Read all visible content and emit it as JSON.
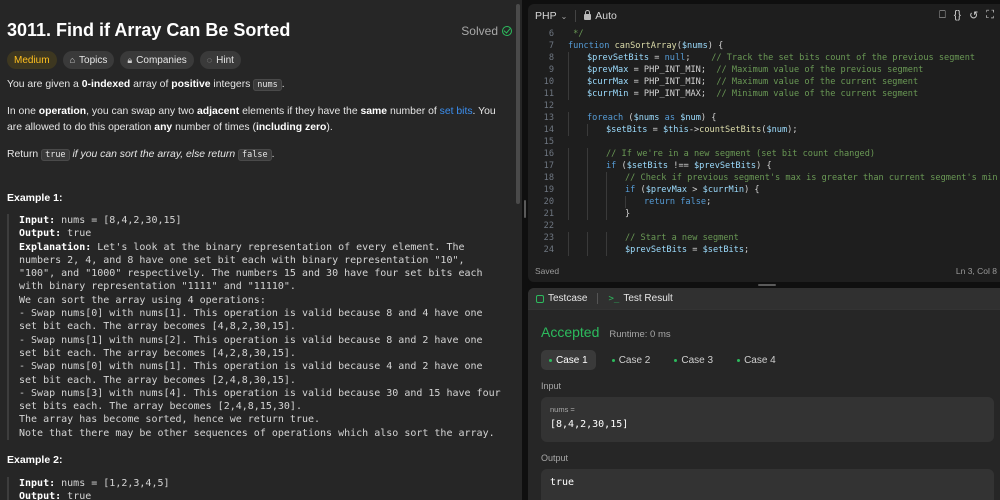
{
  "problem": {
    "title": "3011. Find if Array Can Be Sorted",
    "solved_label": "Solved",
    "tags": [
      "Medium",
      "Topics",
      "Companies",
      "Hint"
    ],
    "intro_1": "You are given a ",
    "intro_bold1": "0-indexed",
    "intro_2": " array of ",
    "intro_bold2": "positive",
    "intro_3": " integers ",
    "intro_code": "nums",
    "intro_4": ".",
    "p2_1": "In one ",
    "p2_b1": "operation",
    "p2_2": ", you can swap any two ",
    "p2_b2": "adjacent",
    "p2_3": " elements if they have the ",
    "p2_b3": "same",
    "p2_4": " number of ",
    "p2_link": "set bits",
    "p2_5": ". You are allowed to do this operation ",
    "p2_b4": "any",
    "p2_6": " number of times (",
    "p2_b5": "including zero",
    "p2_7": ").",
    "p3_1": "Return ",
    "p3_code1": "true",
    "p3_2": " if you can sort the array, else return ",
    "p3_code2": "false",
    "p3_3": ".",
    "example1_title": "Example 1:",
    "example1_lines": [
      {
        "label": "Input:",
        "text": " nums = [8,4,2,30,15]"
      },
      {
        "label": "Output:",
        "text": " true"
      },
      {
        "label": "Explanation:",
        "text": " Let's look at the binary representation of every element. The numbers 2, 4, and 8 have one set bit each with binary representation \"10\", \"100\", and \"1000\" respectively. The numbers 15 and 30 have four set bits each with binary representation \"1111\" and \"11110\"."
      },
      {
        "label": "",
        "text": "We can sort the array using 4 operations:"
      },
      {
        "label": "",
        "text": "- Swap nums[0] with nums[1]. This operation is valid because 8 and 4 have one set bit each. The array becomes [4,8,2,30,15]."
      },
      {
        "label": "",
        "text": "- Swap nums[1] with nums[2]. This operation is valid because 8 and 2 have one set bit each. The array becomes [4,2,8,30,15]."
      },
      {
        "label": "",
        "text": "- Swap nums[0] with nums[1]. This operation is valid because 4 and 2 have one set bit each. The array becomes [2,4,8,30,15]."
      },
      {
        "label": "",
        "text": "- Swap nums[3] with nums[4]. This operation is valid because 30 and 15 have four set bits each. The array becomes [2,4,8,15,30]."
      },
      {
        "label": "",
        "text": "The array has become sorted, hence we return true."
      },
      {
        "label": "",
        "text": "Note that there may be other sequences of operations which also sort the array."
      }
    ],
    "example2_title": "Example 2:",
    "example2_lines": [
      {
        "label": "Input:",
        "text": " nums = [1,2,3,4,5]"
      },
      {
        "label": "Output:",
        "text": " true"
      }
    ]
  },
  "editor": {
    "language": "PHP",
    "mode": "Auto",
    "status_left": "Saved",
    "status_right": "Ln 3, Col 8",
    "lines": [
      {
        "n": "6",
        "indent": 0,
        "html": "<span class='cm'> */</span>"
      },
      {
        "n": "7",
        "indent": 0,
        "html": "<span class='kw'>function</span> <span class='fn'>canSortArray</span>(<span class='vr'>$nums</span>) {"
      },
      {
        "n": "8",
        "indent": 1,
        "html": "<span class='vr'>$prevSetBits</span> = <span class='kw'>null</span>;    <span class='cm'>// Track the set bits count of the previous segment</span>"
      },
      {
        "n": "9",
        "indent": 1,
        "html": "<span class='vr'>$prevMax</span> = PHP_INT_MIN;  <span class='cm'>// Maximum value of the previous segment</span>"
      },
      {
        "n": "10",
        "indent": 1,
        "html": "<span class='vr'>$currMax</span> = PHP_INT_MIN;  <span class='cm'>// Maximum value of the current segment</span>"
      },
      {
        "n": "11",
        "indent": 1,
        "html": "<span class='vr'>$currMin</span> = PHP_INT_MAX;  <span class='cm'>// Minimum value of the current segment</span>"
      },
      {
        "n": "12",
        "indent": 0,
        "html": ""
      },
      {
        "n": "13",
        "indent": 1,
        "html": "<span class='kw'>foreach</span> (<span class='vr'>$nums</span> <span class='kw'>as</span> <span class='vr'>$num</span>) {"
      },
      {
        "n": "14",
        "indent": 2,
        "html": "<span class='vr'>$setBits</span> = <span class='vr'>$this</span>-&gt;<span class='fn'>countSetBits</span>(<span class='vr'>$num</span>);"
      },
      {
        "n": "15",
        "indent": 0,
        "html": ""
      },
      {
        "n": "16",
        "indent": 2,
        "html": "<span class='cm'>// If we're in a new segment (set bit count changed)</span>"
      },
      {
        "n": "17",
        "indent": 2,
        "html": "<span class='kw'>if</span> (<span class='vr'>$setBits</span> !== <span class='vr'>$prevSetBits</span>) {"
      },
      {
        "n": "18",
        "indent": 3,
        "html": "<span class='cm'>// Check if previous segment's max is greater than current segment's min</span>"
      },
      {
        "n": "19",
        "indent": 3,
        "html": "<span class='kw'>if</span> (<span class='vr'>$prevMax</span> &gt; <span class='vr'>$currMin</span>) {"
      },
      {
        "n": "20",
        "indent": 4,
        "html": "<span class='kw'>return</span> <span class='kw'>false</span>;"
      },
      {
        "n": "21",
        "indent": 3,
        "html": "}"
      },
      {
        "n": "22",
        "indent": 0,
        "html": ""
      },
      {
        "n": "23",
        "indent": 3,
        "html": "<span class='cm'>// Start a new segment</span>"
      },
      {
        "n": "24",
        "indent": 3,
        "html": "<span class='vr'>$prevSetBits</span> = <span class='vr'>$setBits</span>;"
      }
    ]
  },
  "result": {
    "tab_testcase": "Testcase",
    "tab_result": "Test Result",
    "status": "Accepted",
    "runtime": "Runtime: 0 ms",
    "cases": [
      "Case 1",
      "Case 2",
      "Case 3",
      "Case 4"
    ],
    "input_label": "Input",
    "input_var": "nums =",
    "input_value": "[8,4,2,30,15]",
    "output_label": "Output",
    "output_value": "true"
  },
  "colors": {
    "accent_green": "#2cbb5d",
    "medium_yellow": "#ffc01e",
    "link_blue": "#3b8ff0"
  }
}
